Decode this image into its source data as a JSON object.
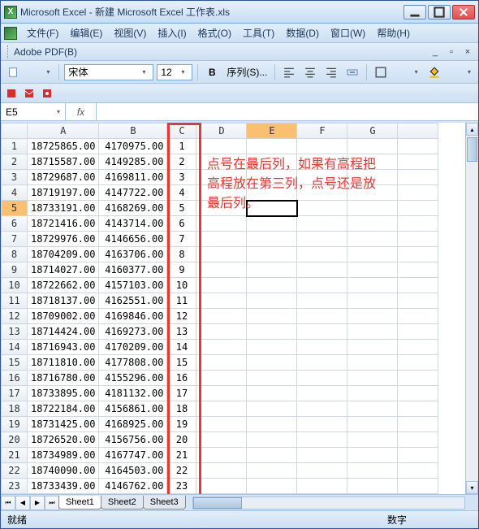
{
  "window": {
    "title": "Microsoft Excel - 新建 Microsoft Excel 工作表.xls"
  },
  "menu": {
    "file": "文件(F)",
    "edit": "编辑(E)",
    "view": "视图(V)",
    "insert": "插入(I)",
    "format": "格式(O)",
    "tools": "工具(T)",
    "data": "数据(D)",
    "window": "窗口(W)",
    "help": "帮助(H)"
  },
  "pdfbar": {
    "label": "Adobe PDF(B)"
  },
  "toolbar": {
    "font": "宋体",
    "size": "12",
    "bold": "B",
    "series": "序列(S)..."
  },
  "formula": {
    "namebox": "E5",
    "fx": "fx",
    "value": ""
  },
  "columns": [
    "A",
    "B",
    "C",
    "D",
    "E",
    "F",
    "G"
  ],
  "rows": [
    {
      "n": 1,
      "a": "18725865.00",
      "b": "4170975.00",
      "c": "1"
    },
    {
      "n": 2,
      "a": "18715587.00",
      "b": "4149285.00",
      "c": "2"
    },
    {
      "n": 3,
      "a": "18729687.00",
      "b": "4169811.00",
      "c": "3"
    },
    {
      "n": 4,
      "a": "18719197.00",
      "b": "4147722.00",
      "c": "4"
    },
    {
      "n": 5,
      "a": "18733191.00",
      "b": "4168269.00",
      "c": "5"
    },
    {
      "n": 6,
      "a": "18721416.00",
      "b": "4143714.00",
      "c": "6"
    },
    {
      "n": 7,
      "a": "18729976.00",
      "b": "4146656.00",
      "c": "7"
    },
    {
      "n": 8,
      "a": "18704209.00",
      "b": "4163706.00",
      "c": "8"
    },
    {
      "n": 9,
      "a": "18714027.00",
      "b": "4160377.00",
      "c": "9"
    },
    {
      "n": 10,
      "a": "18722662.00",
      "b": "4157103.00",
      "c": "10"
    },
    {
      "n": 11,
      "a": "18718137.00",
      "b": "4162551.00",
      "c": "11"
    },
    {
      "n": 12,
      "a": "18709002.00",
      "b": "4169846.00",
      "c": "12"
    },
    {
      "n": 13,
      "a": "18714424.00",
      "b": "4169273.00",
      "c": "13"
    },
    {
      "n": 14,
      "a": "18716943.00",
      "b": "4170209.00",
      "c": "14"
    },
    {
      "n": 15,
      "a": "18711810.00",
      "b": "4177808.00",
      "c": "15"
    },
    {
      "n": 16,
      "a": "18716780.00",
      "b": "4155296.00",
      "c": "16"
    },
    {
      "n": 17,
      "a": "18733895.00",
      "b": "4181132.00",
      "c": "17"
    },
    {
      "n": 18,
      "a": "18722184.00",
      "b": "4156861.00",
      "c": "18"
    },
    {
      "n": 19,
      "a": "18731425.00",
      "b": "4168925.00",
      "c": "19"
    },
    {
      "n": 20,
      "a": "18726520.00",
      "b": "4156756.00",
      "c": "20"
    },
    {
      "n": 21,
      "a": "18734989.00",
      "b": "4167747.00",
      "c": "21"
    },
    {
      "n": 22,
      "a": "18740090.00",
      "b": "4164503.00",
      "c": "22"
    },
    {
      "n": 23,
      "a": "18733439.00",
      "b": "4146762.00",
      "c": "23"
    }
  ],
  "annotation": {
    "line1": "点号在最后列，如果有高程把",
    "line2": "高程放在第三列，点号还是放",
    "line3": "最后列。"
  },
  "sheets": {
    "s1": "Sheet1",
    "s2": "Sheet2",
    "s3": "Sheet3"
  },
  "status": {
    "left": "就绪",
    "right": "数字"
  },
  "selected": {
    "row": 5,
    "col": "E"
  }
}
